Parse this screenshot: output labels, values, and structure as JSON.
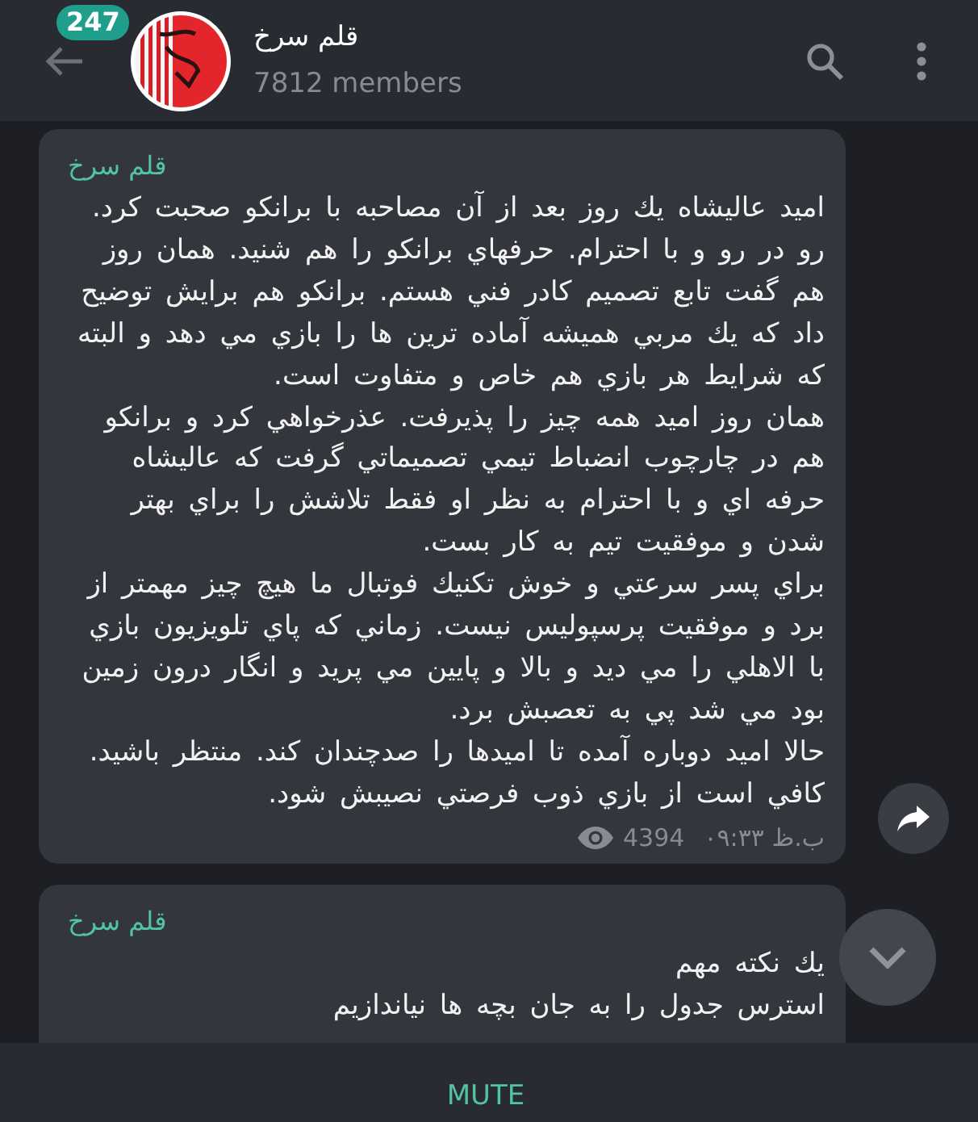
{
  "header": {
    "unread_badge": "247",
    "title": "قلم سرخ",
    "subtitle": "7812 members"
  },
  "messages": [
    {
      "sender": "قلم سرخ",
      "paragraphs": [
        "اميد عاليشاه يك روز بعد از آن مصاحبه با برانكو صحبت كرد. رو در رو و با احترام. حرفهاي برانكو را هم شنيد. همان روز هم گفت تابع تصميم كادر فني هستم. برانكو هم برايش توضيح داد كه يك مربي هميشه آماده ترين ها را بازي مي دهد و البته كه شرايط هر بازي هم خاص و متفاوت است.",
        "همان روز اميد همه چيز را پذيرفت. عذرخواهي كرد و برانكو هم در چارچوب انضباط تيمي تصميماتي گرفت كه عاليشاه حرفه اي و با احترام به نظر او فقط تلاشش را براي بهتر شدن و موفقيت تيم به كار بست.",
        "براي پسر سرعتي و خوش تكنيك فوتبال ما هيچ چيز مهمتر از برد و موفقيت پرسپوليس نيست. زماني كه پاي تلويزيون بازي با الاهلي را مي ديد و بالا و پايين مي پريد و انگار درون زمين بود مي شد پي به تعصبش برد.",
        "حالا اميد دوباره آمده تا اميدها را صدچندان كند. منتظر باشيد. كافي است از بازي ذوب فرصتي نصيبش شود."
      ],
      "views": "4394",
      "time": "ب.ظ ۰۹:۳۳"
    },
    {
      "sender": "قلم سرخ",
      "paragraphs": [
        "يك نكته مهم",
        "استرس جدول را به جان بچه ها نياندازيم"
      ]
    }
  ],
  "bottom_bar": {
    "button": "MUTE"
  }
}
